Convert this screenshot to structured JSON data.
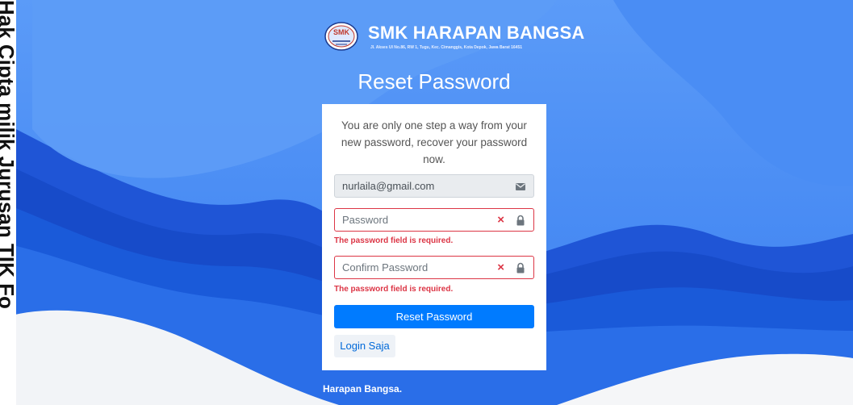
{
  "side_text": "Hak Cipta milik Jurusan TIK Fo",
  "header": {
    "logo_text": "SMK",
    "school_name": "SMK HARAPAN BANGSA",
    "school_address": "Jl. Akses UI No.86, RW 1, Tugu, Kec. Cimanggis, Kota Depok, Jawa Barat 16451"
  },
  "page_title": "Reset Password",
  "form": {
    "intro": "You are only one step a way from your new password, recover your password now.",
    "email_value": "nurlaila@gmail.com",
    "password_placeholder": "Password",
    "password_error": "The password field is required.",
    "confirm_placeholder": "Confirm Password",
    "confirm_error": "The password field is required.",
    "error_mark": "×",
    "submit_label": "Reset Password",
    "login_link": "Login Saja"
  },
  "footer": "Harapan Bangsa.",
  "icons": {
    "email": "envelope-icon",
    "password": "lock-icon",
    "confirm": "lock-icon",
    "error": "x-icon"
  },
  "colors": {
    "primary": "#007bff",
    "error": "#dc3545",
    "background_blue": "#4d90fe"
  }
}
